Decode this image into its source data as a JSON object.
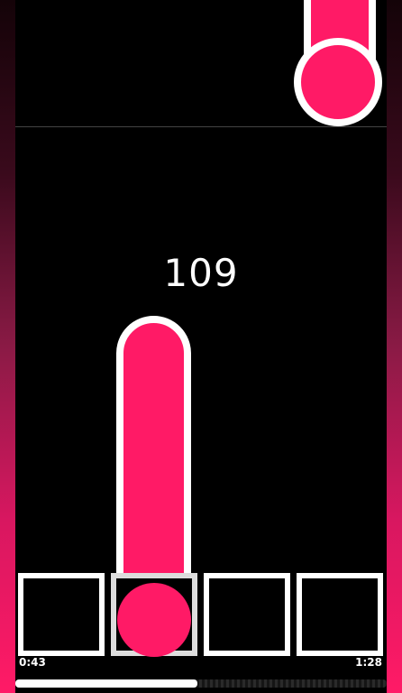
{
  "game": {
    "score": "109",
    "time_elapsed": "0:43",
    "time_total": "1:28",
    "progress_fraction": 0.49
  },
  "colors": {
    "note": "#ff1a66",
    "outline": "#ffffff",
    "background": "#000000"
  }
}
